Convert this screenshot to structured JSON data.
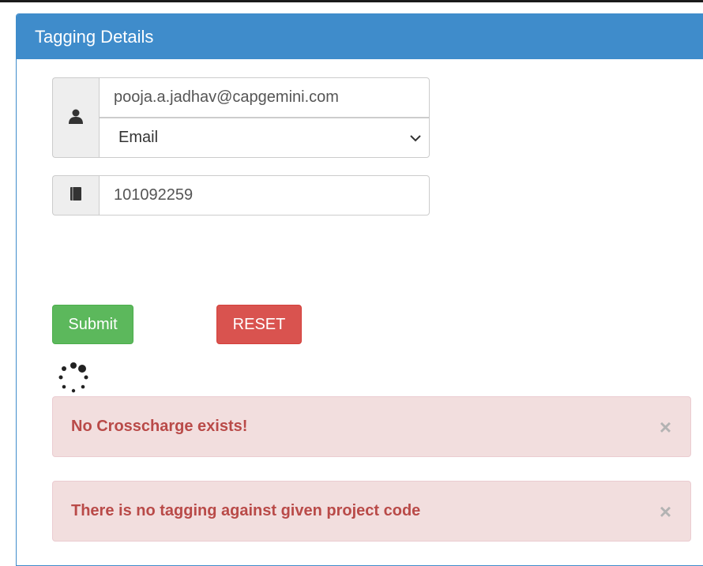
{
  "panel": {
    "title": "Tagging Details"
  },
  "form": {
    "email_value": "pooja.a.jadhav@capgemini.com",
    "type_select_value": "Email",
    "project_code_value": "101092259",
    "user_icon": "user-icon",
    "book_icon": "book-icon"
  },
  "buttons": {
    "submit_label": "Submit",
    "reset_label": "RESET"
  },
  "alerts": [
    {
      "message": "No Crosscharge exists!",
      "close": "×"
    },
    {
      "message": "There is no tagging against given project code",
      "close": "×"
    }
  ],
  "colors": {
    "header": "#3f8ccb",
    "submit": "#5cb85c",
    "reset": "#d9534f",
    "alert_bg": "#f2dede",
    "alert_text": "#b94a48"
  }
}
